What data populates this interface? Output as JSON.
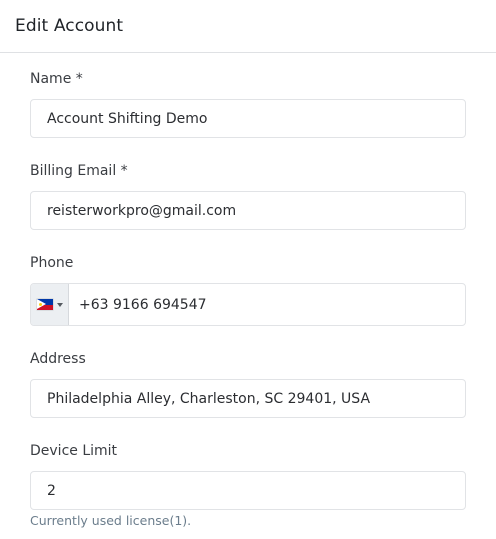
{
  "dialog": {
    "title": "Edit Account"
  },
  "form": {
    "name": {
      "label": "Name *",
      "value": "Account Shifting Demo"
    },
    "billing_email": {
      "label": "Billing Email *",
      "value": "reisterworkpro@gmail.com"
    },
    "phone": {
      "label": "Phone",
      "country_flag": "philippines-flag-icon",
      "value": "+63 9166 694547"
    },
    "address": {
      "label": "Address",
      "value": "Philadelphia Alley, Charleston, SC 29401, USA"
    },
    "device_limit": {
      "label": "Device Limit",
      "value": "2",
      "help": "Currently used license(1)."
    }
  }
}
